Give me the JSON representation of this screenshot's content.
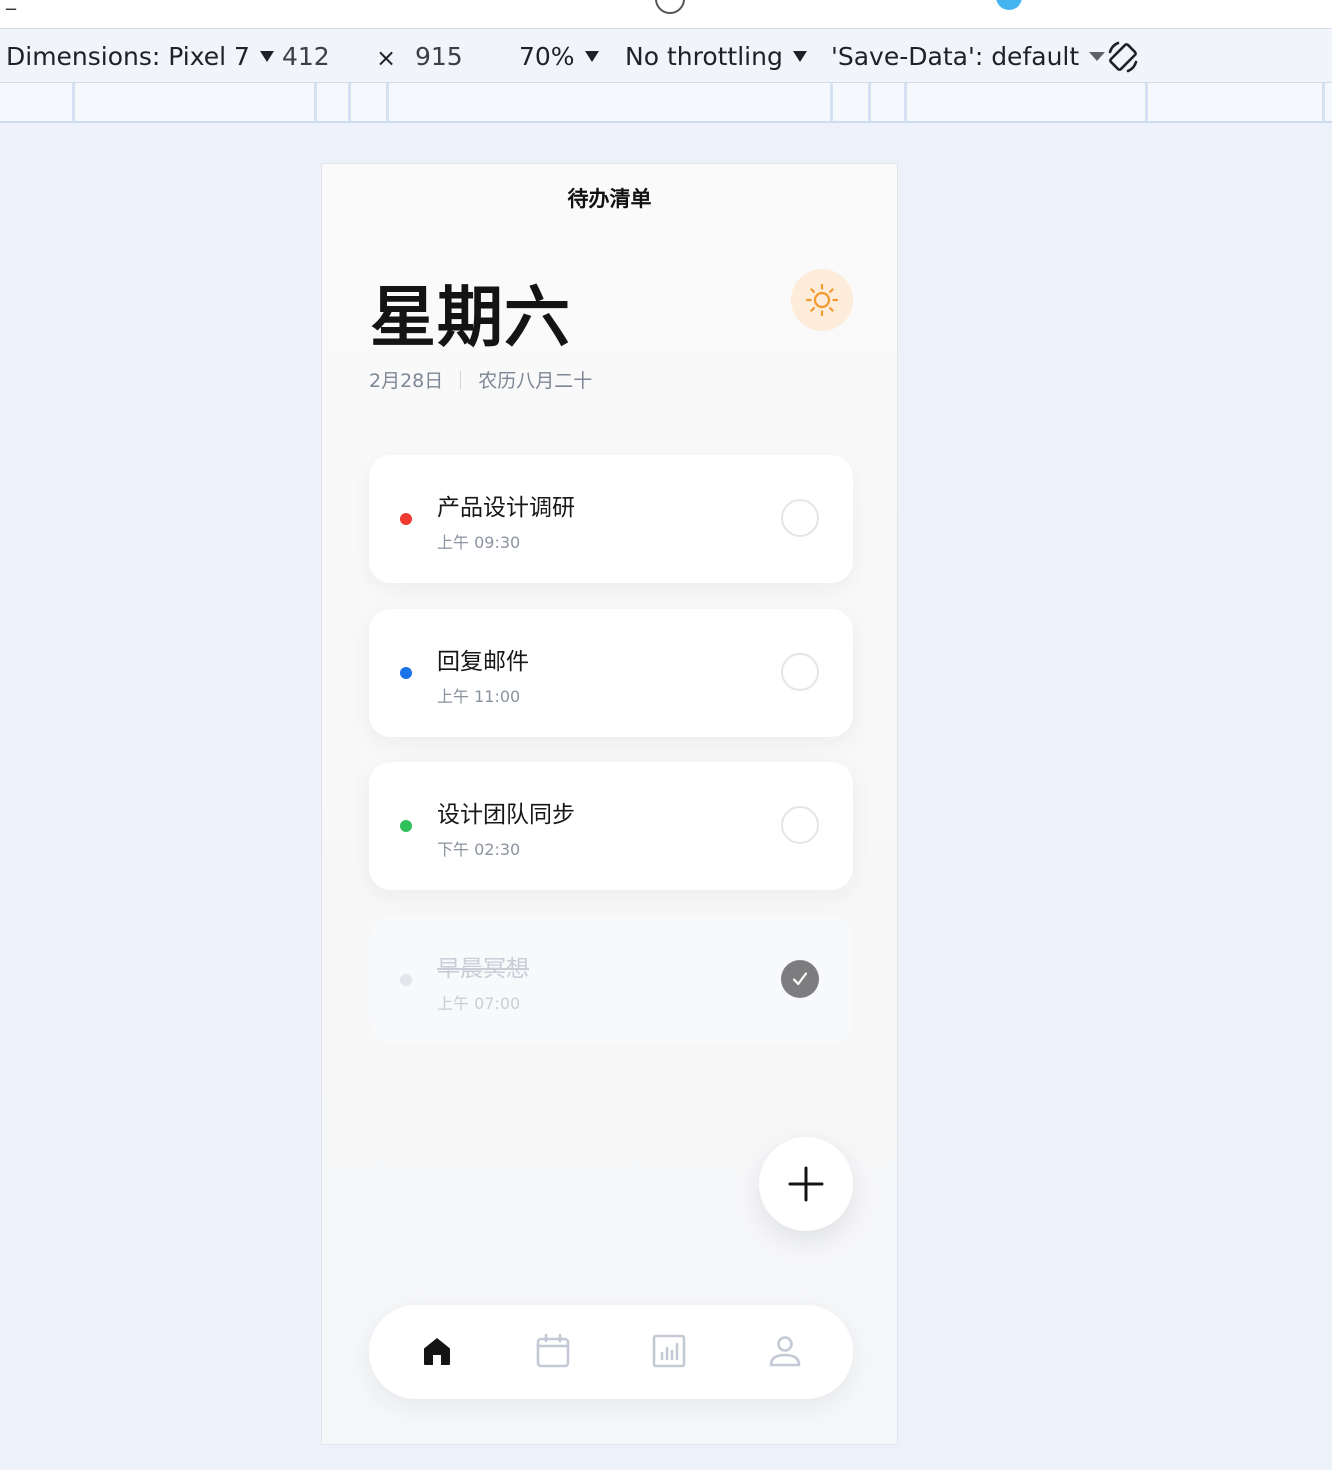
{
  "devtools": {
    "dimensions_label": "Dimensions: Pixel 7",
    "width_value": "412",
    "times": "×",
    "height_value": "915",
    "zoom": "70%",
    "throttling": "No throttling",
    "save_data": "'Save-Data': default"
  },
  "app": {
    "title": "待办清单",
    "day": "星期六",
    "date": "2月28日",
    "lunar": "农历八月二十",
    "tasks": [
      {
        "title": "产品设计调研",
        "time": "上午 09:30",
        "color": "#f0392f",
        "done": false
      },
      {
        "title": "回复邮件",
        "time": "上午 11:00",
        "color": "#1a73e8",
        "done": false
      },
      {
        "title": "设计团队同步",
        "time": "下午 02:30",
        "color": "#2fbf5b",
        "done": false
      },
      {
        "title": "早晨冥想",
        "time": "上午 07:00",
        "color": "#e2e5ea",
        "done": true
      }
    ],
    "nav": [
      {
        "icon": "home-icon",
        "active": true
      },
      {
        "icon": "calendar-icon",
        "active": false
      },
      {
        "icon": "stats-icon",
        "active": false
      },
      {
        "icon": "profile-icon",
        "active": false
      }
    ],
    "theme_icon": "sun-icon",
    "accent": "#f39a2f"
  }
}
